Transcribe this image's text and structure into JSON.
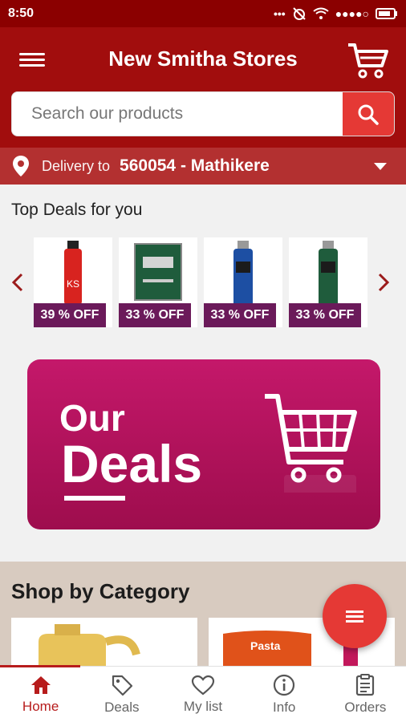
{
  "status_bar": {
    "time": "8:50",
    "icons": [
      "more-dots-icon",
      "no-alarm-icon",
      "wifi-icon",
      "signal-icon",
      "battery-icon"
    ]
  },
  "header": {
    "title": "New Smitha Stores"
  },
  "search": {
    "placeholder": "Search our products"
  },
  "delivery": {
    "label": "Delivery to",
    "location": "560054 - Mathikere"
  },
  "top_deals": {
    "title": "Top Deals for you",
    "items": [
      {
        "badge": "39 % OFF",
        "product_color": "#d8231f"
      },
      {
        "badge": "33 % OFF",
        "product_color": "#1f5c3c"
      },
      {
        "badge": "33 % OFF",
        "product_color": "#1d4fa3"
      },
      {
        "badge": "33 % OFF",
        "product_color": "#1f5c3c"
      }
    ]
  },
  "banner": {
    "line1": "Our",
    "line2": "Deals"
  },
  "shop_by_category": {
    "title": "Shop by Category",
    "tiles": [
      "oil-can",
      "Pasta"
    ]
  },
  "tabs": [
    {
      "label": "Home",
      "icon": "home-icon",
      "active": true
    },
    {
      "label": "Deals",
      "icon": "tag-icon",
      "active": false
    },
    {
      "label": "My list",
      "icon": "heart-icon",
      "active": false
    },
    {
      "label": "Info",
      "icon": "info-icon",
      "active": false
    },
    {
      "label": "Orders",
      "icon": "receipt-icon",
      "active": false
    }
  ],
  "colors": {
    "brand": "#a10d0d",
    "accent": "#e53935",
    "badge": "#6b1a5a",
    "banner": "#b8125f"
  }
}
